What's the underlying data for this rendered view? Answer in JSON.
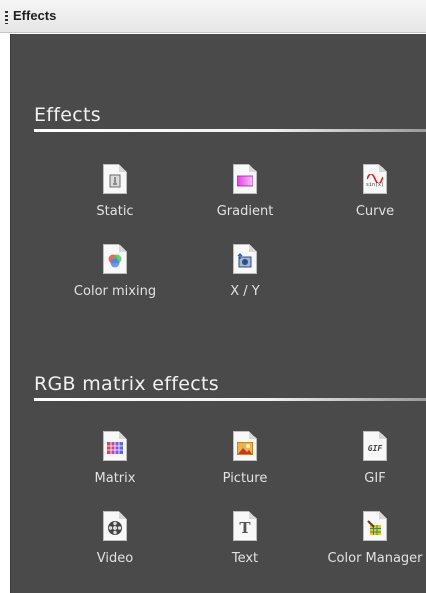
{
  "panel": {
    "title": "Effects"
  },
  "sections": [
    {
      "title": "Effects",
      "items": [
        {
          "label": "Static",
          "icon": "static-icon"
        },
        {
          "label": "Gradient",
          "icon": "gradient-icon"
        },
        {
          "label": "Curve",
          "icon": "curve-icon",
          "icon_text": "sin(x)"
        },
        {
          "label": "Color mixing",
          "icon": "color-mixing-icon"
        },
        {
          "label": "X / Y",
          "icon": "xy-icon"
        }
      ]
    },
    {
      "title": "RGB matrix effects",
      "items": [
        {
          "label": "Matrix",
          "icon": "matrix-icon"
        },
        {
          "label": "Picture",
          "icon": "picture-icon"
        },
        {
          "label": "GIF",
          "icon": "gif-icon",
          "icon_text": "GIF"
        },
        {
          "label": "Video",
          "icon": "video-icon"
        },
        {
          "label": "Text",
          "icon": "text-icon",
          "icon_text": "T"
        },
        {
          "label": "Color Manager",
          "icon": "color-manager-icon"
        }
      ]
    }
  ],
  "colors": {
    "background": "#4a4a4a",
    "label": "#e2e2e2",
    "title": "#f1f1f1"
  }
}
